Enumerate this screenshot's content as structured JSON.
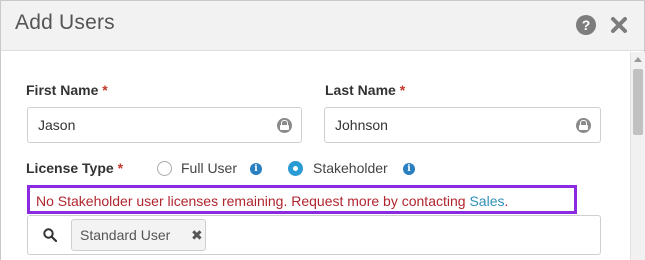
{
  "dialog": {
    "title": "Add Users",
    "help_icon": "?",
    "close_icon": "close-icon"
  },
  "form": {
    "first_name": {
      "label": "First Name",
      "required": "*",
      "value": "Jason"
    },
    "last_name": {
      "label": "Last Name",
      "required": "*",
      "value": "Johnson"
    },
    "license_type": {
      "label": "License Type",
      "required": "*",
      "options": [
        {
          "label": "Full User",
          "selected": false
        },
        {
          "label": "Stakeholder",
          "selected": true
        }
      ]
    },
    "alert": {
      "message": "No Stakeholder user licenses remaining. Request more by contacting ",
      "link": "Sales",
      "suffix": ".",
      "border_color": "#8a2be2",
      "text_color": "#b0262e"
    },
    "user_search": {
      "tag_label": "Standard User",
      "tag_remove": "✖"
    }
  },
  "colors": {
    "accent": "#2a9bd4",
    "required": "#c0392b",
    "header_bg": "#f2f2f2"
  }
}
